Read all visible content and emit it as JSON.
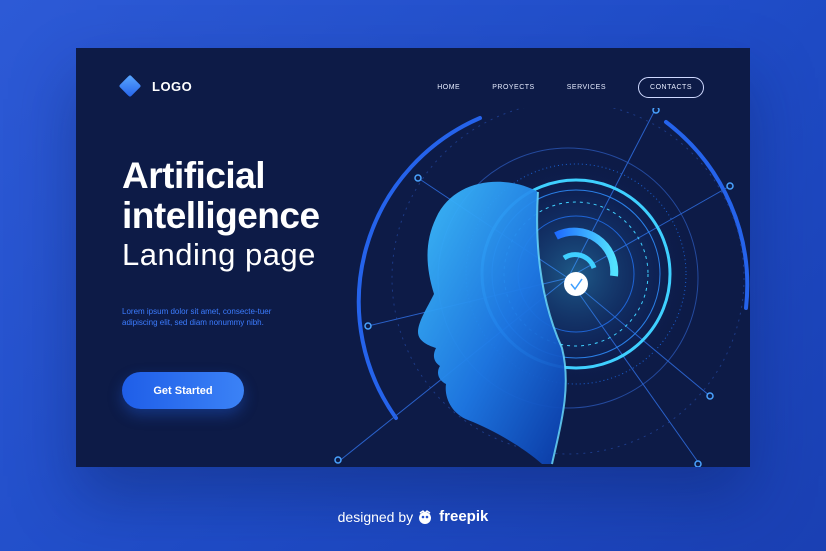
{
  "logo": {
    "text": "LOGO"
  },
  "nav": {
    "items": [
      "HOME",
      "PROYECTS",
      "SERVICES"
    ],
    "contacts": "CONTACTS"
  },
  "hero": {
    "title_line1": "Artificial",
    "title_line2": "intelligence",
    "subtitle": "Landing page",
    "description": "Lorem ipsum dolor sit amet, consecte-tuer adipiscing elit, sed diam nonummy nibh.",
    "cta": "Get Started"
  },
  "footer": {
    "prefix": "designed by",
    "brand": "freepik"
  },
  "colors": {
    "page_bg": "#2350cf",
    "card_bg": "#0d1b47",
    "accent": "#2f6df0",
    "glow": "#3fd0ff",
    "description_text": "#3c7cff"
  },
  "icons": {
    "logo_mark": "diamond-logo-icon",
    "footer_brand": "freepik-logo-icon",
    "illustration": "ai-head-illustration"
  }
}
